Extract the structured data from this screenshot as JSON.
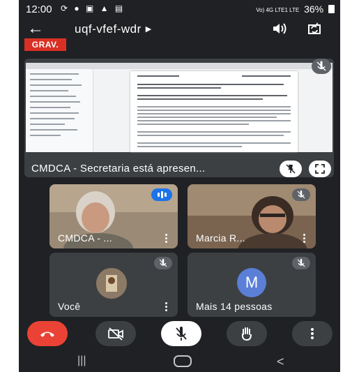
{
  "status_bar": {
    "time": "12:00",
    "left_icons": "⟳ ● ▣ ▲ ▤",
    "network": "Vo) 4G LTE1 LTE",
    "battery": "36%"
  },
  "app_bar": {
    "meeting_code": "uqf-vfef-wdr"
  },
  "recording_badge": "GRAV.",
  "presentation": {
    "presenter_text": "CMDCA - Secretaria está apresen..."
  },
  "participants": [
    {
      "name": "CMDCA - ...",
      "speaking": true
    },
    {
      "name": "Marcia R...",
      "muted": true
    },
    {
      "name": "Você",
      "muted": true
    },
    {
      "name": "Mais 14 pessoas",
      "avatar_letter": "M",
      "muted": true
    }
  ],
  "colors": {
    "background": "#202124",
    "tile": "#3c4043",
    "record_red": "#d93025",
    "hangup_red": "#ea4335",
    "speaking_blue": "#1a73e8",
    "avatar_blue": "#5b7fd6"
  },
  "icons": {
    "back": "arrow-left",
    "speaker": "speaker-icon",
    "camera_flip": "camera-flip-icon",
    "hang_up": "phone-hangup-icon",
    "camera_off": "video-off-icon",
    "mic_off": "mic-off-icon",
    "raise_hand": "hand-icon",
    "more": "more-vert-icon"
  }
}
